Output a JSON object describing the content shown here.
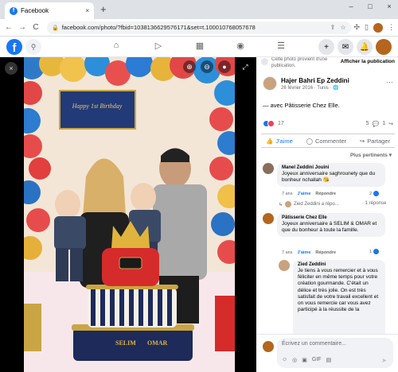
{
  "browser": {
    "tab_title": "Facebook",
    "tab_close": "×",
    "new_tab": "+",
    "window_controls": [
      "–",
      "□",
      "×"
    ],
    "nav": [
      "←",
      "→",
      "C"
    ],
    "url": "facebook.com/photo/?fbid=1038136629576171&set=t.100010768057678"
  },
  "fb_header": {
    "logo": "f",
    "icons": [
      "search-icon",
      "home-icon",
      "video-icon",
      "marketplace-icon",
      "groups-icon",
      "menu-icon",
      "create-icon",
      "messenger-icon",
      "notifications-icon",
      "account-avatar"
    ]
  },
  "viewer": {
    "close": "×",
    "tools": [
      "⊕",
      "⊖",
      "●"
    ],
    "fullscreen": "⤢",
    "photo": {
      "banner_text": "Happy 1st Birthday",
      "cake_names": [
        "SELIM",
        "OMAR"
      ]
    }
  },
  "panel": {
    "notice_text": "Cette photo provient d'une publication.",
    "notice_button": "Afficher la publication",
    "author_name": "Hajer Bahri Ep Zeddini",
    "author_date": "26 février 2016 · Tunis · ",
    "more": "···",
    "with_text": "— avec Pâtisserie Chez Elle.",
    "reaction_count": "17",
    "comment_count": "5",
    "share_count": "1",
    "actions": {
      "like": "J'aime",
      "comment": "Commenter",
      "share": "Partager"
    },
    "sort_label": "Plus pertinents ▾",
    "comments": [
      {
        "name": "Manel Zeddini Jouini",
        "text": "Joyeux anniversaire saghrounety que du bonheur nchallah 😘",
        "age": "7 ans",
        "like": "J'aime",
        "reply": "Répondre",
        "badge": "2"
      },
      {
        "name": "Pâtisserie Chez Elle",
        "text": "Joyeux anniversaire à SELIM & OMAR et que du bonheur à toute la famille.",
        "age": "7 ans",
        "like": "J'aime",
        "reply": "Répondre",
        "badge": "1"
      },
      {
        "name": "Zied Zeddini",
        "text": "Je tiens à vous remercier et à vous féliciter en même temps pour votre création gourmande. C'était un délice et très jolie. On est très satisfait de votre travail excellent et on vous remercie car vous avez participé à la réussite de la"
      }
    ],
    "reply_preview": "Zied Zeddini a répo...",
    "reply_count": "· 1 réponse",
    "composer_placeholder": "Écrivez un commentaire...",
    "composer_icons": [
      "☺",
      "◎",
      "▣",
      "GIF",
      "▤"
    ],
    "send": "➤"
  }
}
